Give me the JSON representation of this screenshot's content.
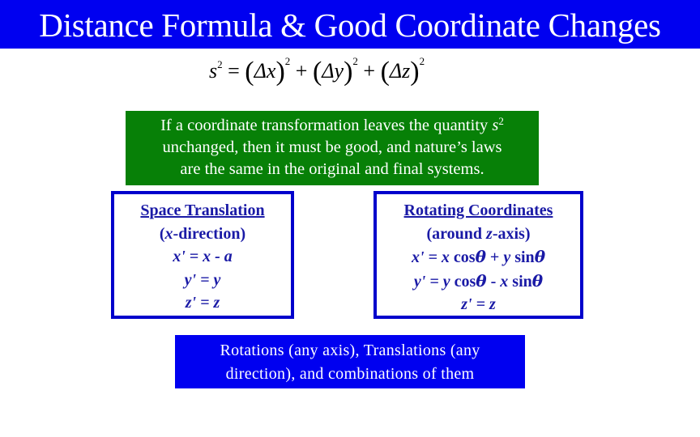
{
  "title": "Distance Formula & Good Coordinate Changes",
  "formula": {
    "lhs": "s",
    "exponent": "2",
    "equals": "=",
    "terms": [
      "Δx",
      "Δy",
      "Δz"
    ],
    "plus": "+"
  },
  "invariance_note": {
    "line1_text": "If a coordinate transformation leaves the quantity ",
    "line1_var": "s",
    "line1_exp": "2",
    "line2": "unchanged, then it must be good, and nature’s laws",
    "line3": "are the same in the original and final systems."
  },
  "translation_panel": {
    "heading": "Space Translation",
    "subheading_open": "(",
    "subheading_var": "x",
    "subheading_rest": "-direction)",
    "equations": [
      "x' = x - a",
      "y' = y",
      "z' = z"
    ]
  },
  "rotation_panel": {
    "heading": "Rotating Coordinates",
    "subheading_open": "(around ",
    "subheading_var": "z",
    "subheading_rest": "-axis)",
    "eq1": {
      "a": "x' = x",
      "b": " cos",
      "theta": "θ",
      "c": " + ",
      "d": "y",
      "e": " sin",
      "theta2": "θ"
    },
    "eq2": {
      "a": "y' = y",
      "b": " cos",
      "theta": "θ",
      "c": " -  ",
      "d": "x",
      "e": " sin",
      "theta2": "θ"
    },
    "eq3": "z' = z"
  },
  "summary": {
    "line1": "Rotations (any axis), Translations (any",
    "line2": "direction), and combinations of them"
  },
  "colors": {
    "title_bg": "#0000f0",
    "note_bg": "#078007",
    "panel_border": "#0000cc",
    "panel_text": "#1a1aa6",
    "summary_bg": "#0000f0"
  }
}
